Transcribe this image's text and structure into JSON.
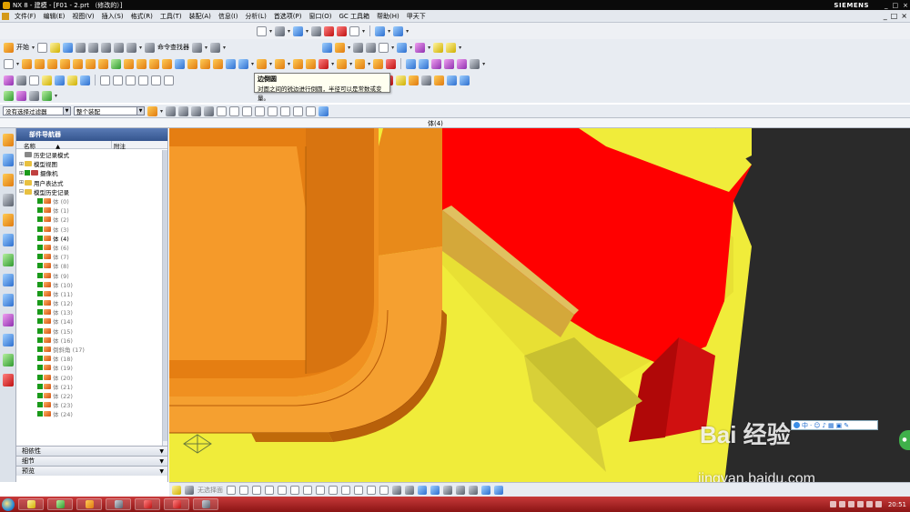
{
  "window": {
    "title": "NX 8 - 建模 - [F01 - 2.prt （修改的）]",
    "brand": "SIEMENS",
    "buttons": [
      "_",
      "□",
      "×"
    ]
  },
  "menu": {
    "items": [
      "文件(F)",
      "编辑(E)",
      "视图(V)",
      "插入(S)",
      "格式(R)",
      "工具(T)",
      "装配(A)",
      "信息(I)",
      "分析(L)",
      "首选项(P)",
      "窗口(O)",
      "GC 工具箱",
      "帮助(H)",
      "甲天下"
    ],
    "mdi_buttons": [
      "_",
      "□",
      "×"
    ]
  },
  "toolbar": {
    "start_label": "开始",
    "command_finder_label": "命令查找器"
  },
  "tooltip": {
    "title": "边倒圆",
    "body": "对面之间的锐边进行倒圆，半径可以是常数或变量。"
  },
  "selection_bar": {
    "filter_value": "没有选择过滤器",
    "scope_value": "整个装配"
  },
  "status": {
    "center_text": "体(4)"
  },
  "navigator": {
    "title": "部件导航器",
    "col_name": "名称",
    "col_sort": "▲",
    "col_attach": "附注",
    "tree": [
      {
        "label": "历史记录模式",
        "toggle": "",
        "level": 0,
        "type": "mode"
      },
      {
        "label": "模型视图",
        "toggle": "+",
        "level": 0,
        "type": "folder"
      },
      {
        "label": "摄像机",
        "toggle": "+",
        "level": 0,
        "type": "camera"
      },
      {
        "label": "用户表达式",
        "toggle": "+",
        "level": 0,
        "type": "folder"
      },
      {
        "label": "模型历史记录",
        "toggle": "-",
        "level": 0,
        "type": "folder"
      },
      {
        "label": "体 (0)",
        "toggle": "",
        "level": 1,
        "type": "feat"
      },
      {
        "label": "体 (1)",
        "toggle": "",
        "level": 1,
        "type": "feat"
      },
      {
        "label": "体 (2)",
        "toggle": "",
        "level": 1,
        "type": "feat"
      },
      {
        "label": "体 (3)",
        "toggle": "",
        "level": 1,
        "type": "feat"
      },
      {
        "label": "体 (4)",
        "toggle": "",
        "level": 1,
        "type": "feat-active"
      },
      {
        "label": "体 (6)",
        "toggle": "",
        "level": 1,
        "type": "feat"
      },
      {
        "label": "体 (7)",
        "toggle": "",
        "level": 1,
        "type": "feat"
      },
      {
        "label": "体 (8)",
        "toggle": "",
        "level": 1,
        "type": "feat"
      },
      {
        "label": "体 (9)",
        "toggle": "",
        "level": 1,
        "type": "feat"
      },
      {
        "label": "体 (10)",
        "toggle": "",
        "level": 1,
        "type": "feat"
      },
      {
        "label": "体 (11)",
        "toggle": "",
        "level": 1,
        "type": "feat"
      },
      {
        "label": "体 (12)",
        "toggle": "",
        "level": 1,
        "type": "feat"
      },
      {
        "label": "体 (13)",
        "toggle": "",
        "level": 1,
        "type": "feat"
      },
      {
        "label": "体 (14)",
        "toggle": "",
        "level": 1,
        "type": "feat"
      },
      {
        "label": "体 (15)",
        "toggle": "",
        "level": 1,
        "type": "feat"
      },
      {
        "label": "体 (16)",
        "toggle": "",
        "level": 1,
        "type": "feat"
      },
      {
        "label": "倒斜角 (17)",
        "toggle": "",
        "level": 1,
        "type": "feat"
      },
      {
        "label": "体 (18)",
        "toggle": "",
        "level": 1,
        "type": "feat"
      },
      {
        "label": "体 (19)",
        "toggle": "",
        "level": 1,
        "type": "feat"
      },
      {
        "label": "体 (20)",
        "toggle": "",
        "level": 1,
        "type": "feat"
      },
      {
        "label": "体 (21)",
        "toggle": "",
        "level": 1,
        "type": "feat"
      },
      {
        "label": "体 (22)",
        "toggle": "",
        "level": 1,
        "type": "feat"
      },
      {
        "label": "体 (23)",
        "toggle": "",
        "level": 1,
        "type": "feat"
      },
      {
        "label": "体 (24)",
        "toggle": "",
        "level": 1,
        "type": "feat"
      }
    ],
    "panels": [
      "相依性",
      "细节",
      "预览"
    ]
  },
  "bottombar": {
    "mode_label": "无选择面"
  },
  "watermark": {
    "logo": "Bai 经验",
    "url": "jingyan.baidu.com"
  },
  "taskbar": {
    "clock": "20:51"
  }
}
